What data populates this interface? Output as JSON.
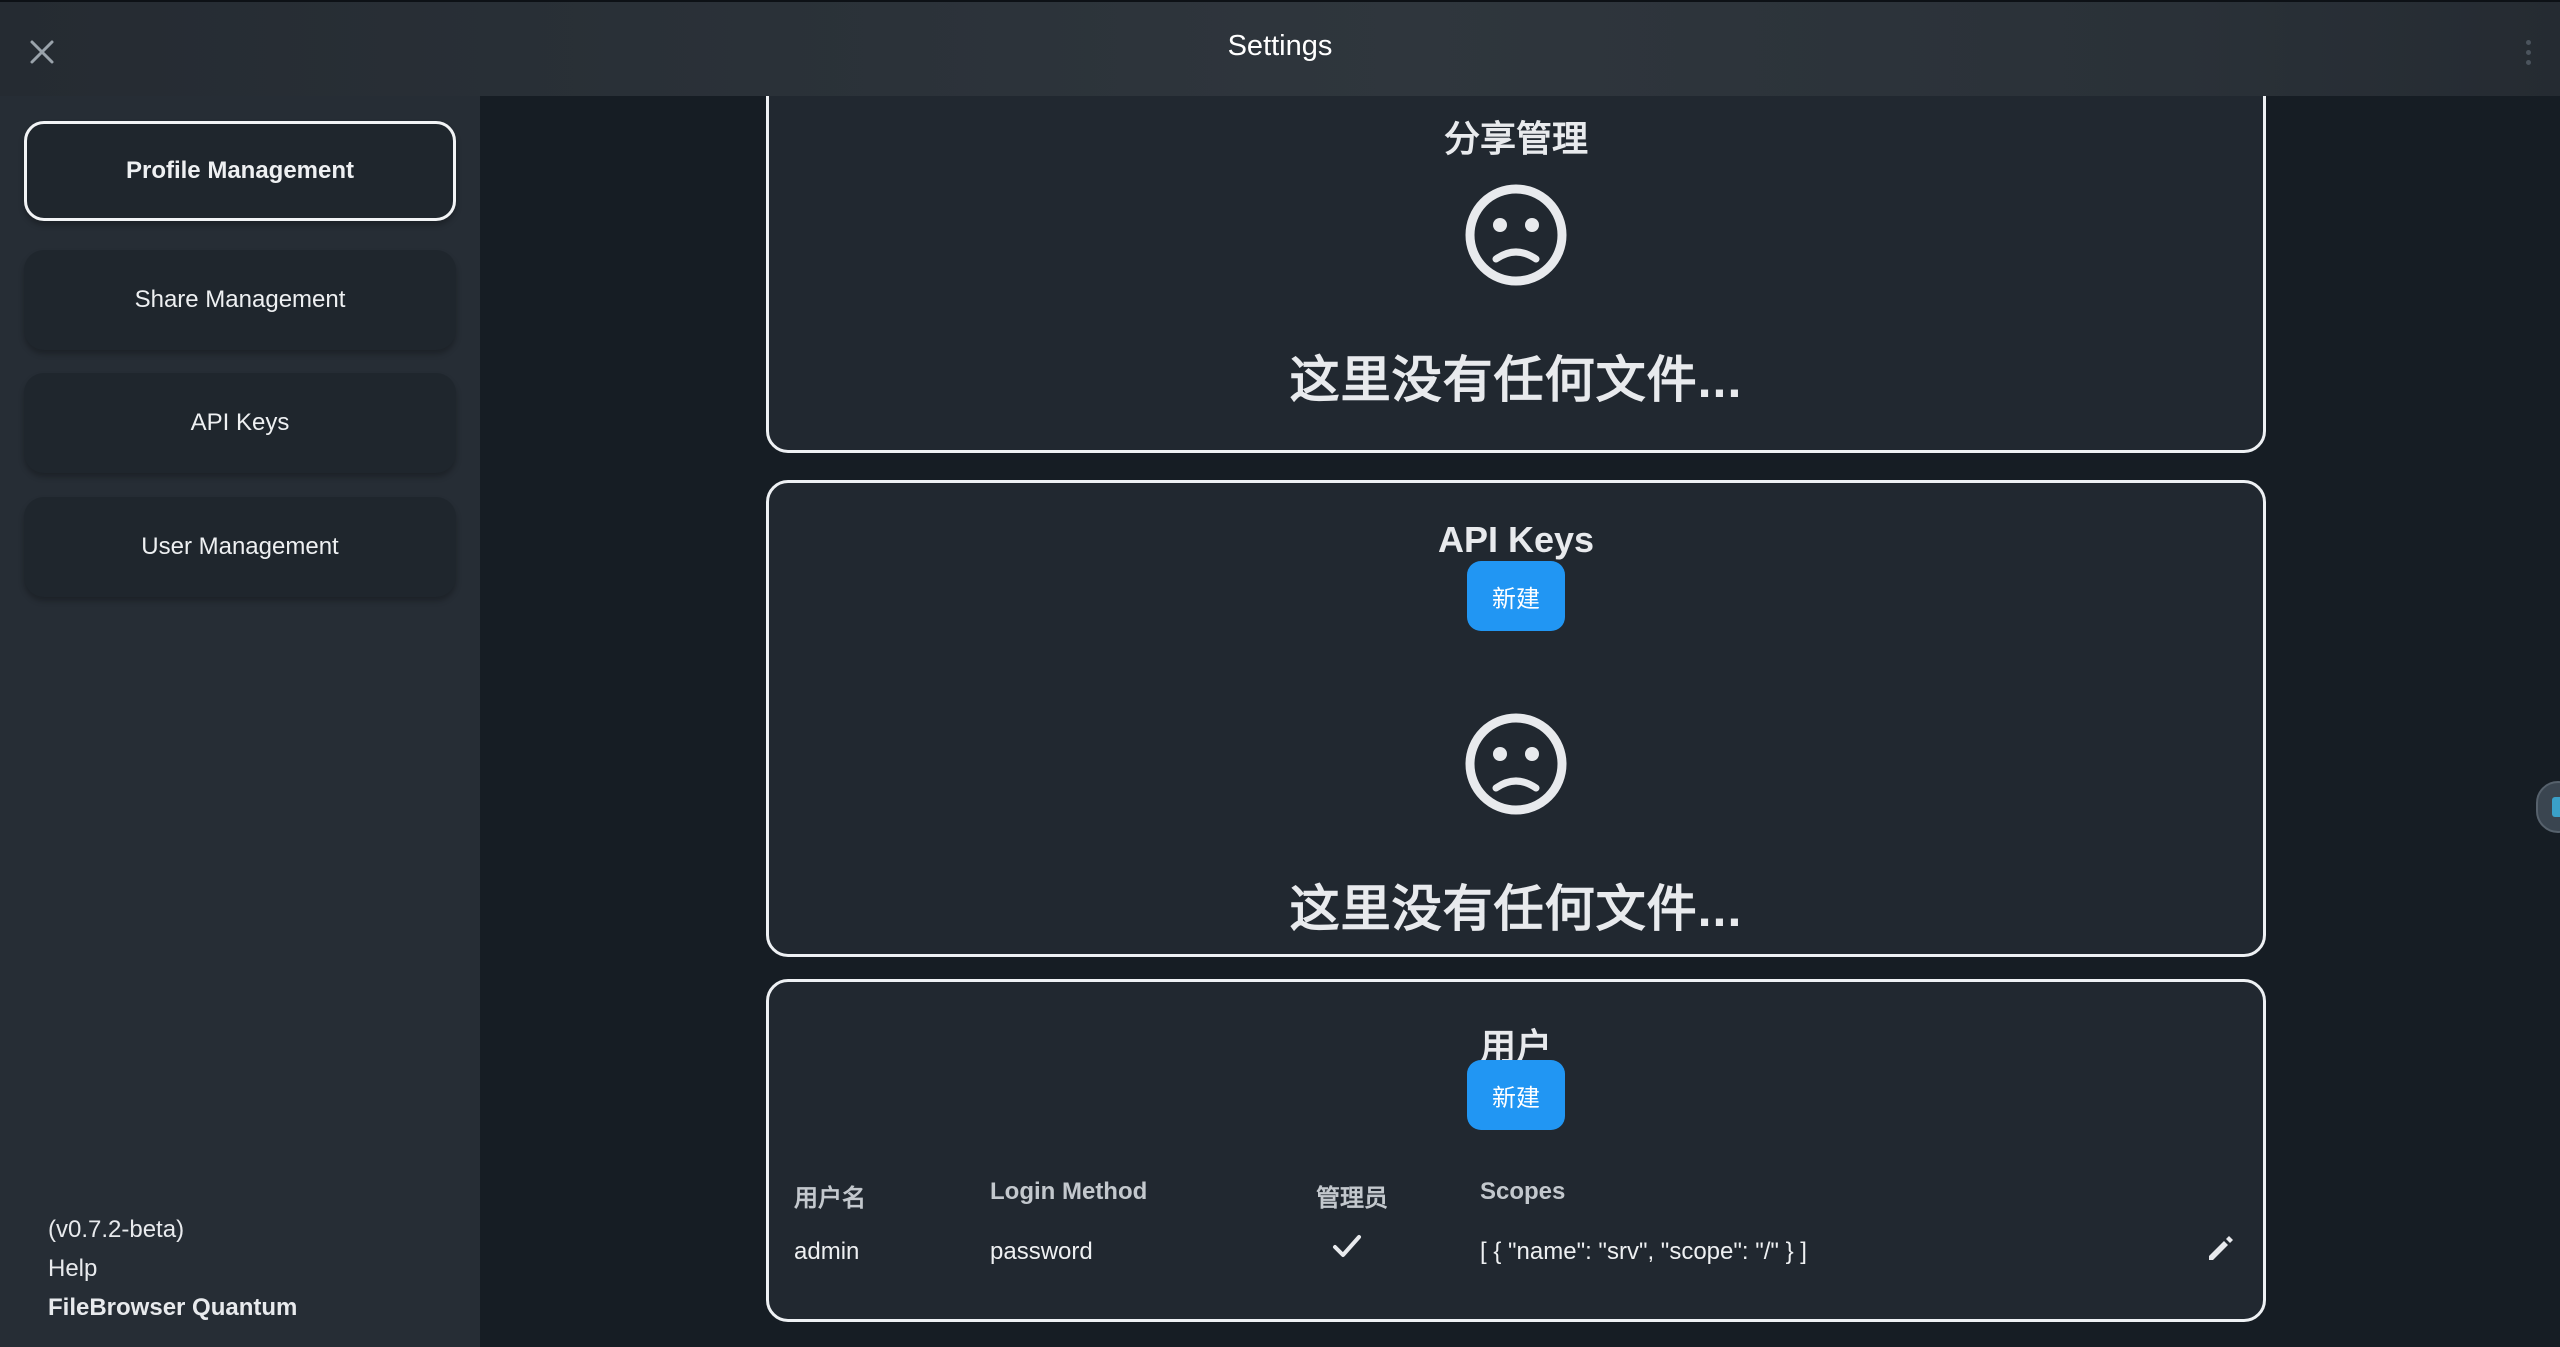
{
  "header": {
    "title": "Settings"
  },
  "sidebar": {
    "items": [
      {
        "label": "Profile Management"
      },
      {
        "label": "Share Management"
      },
      {
        "label": "API Keys"
      },
      {
        "label": "User Management"
      }
    ],
    "footer": {
      "version": "(v0.7.2-beta)",
      "help": "Help",
      "brand": "FileBrowser Quantum"
    }
  },
  "share_card": {
    "title": "分享管理",
    "empty_text": "这里没有任何文件..."
  },
  "api_card": {
    "title": "API Keys",
    "new_label": "新建",
    "empty_text": "这里没有任何文件..."
  },
  "users_card": {
    "title": "用户",
    "new_label": "新建",
    "columns": [
      "用户名",
      "Login Method",
      "管理员",
      "Scopes"
    ],
    "rows": [
      {
        "username": "admin",
        "login_method": "password",
        "admin": true,
        "scopes": "[ { \"name\": \"srv\", \"scope\": \"/\" } ]"
      }
    ]
  },
  "icons": {
    "close": "close-icon",
    "more": "more-vertical-icon",
    "empty": "sad-face-icon",
    "check": "check-icon",
    "edit": "pencil-icon"
  },
  "colors": {
    "accent": "#2196f3",
    "card_bg": "#212830",
    "page_bg": "#161d24",
    "sidebar_bg": "#262d35"
  }
}
